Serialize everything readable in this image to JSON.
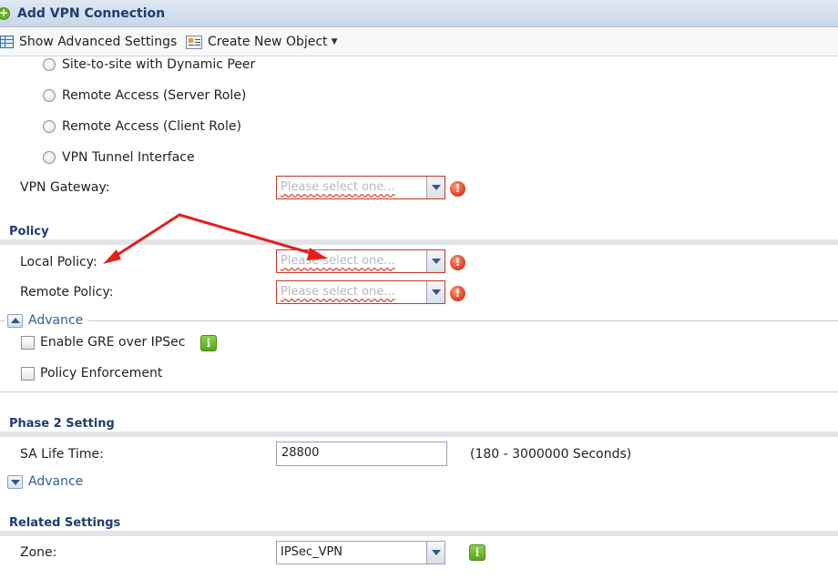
{
  "window": {
    "title": "Add VPN Connection"
  },
  "toolbar": {
    "show_advanced": "Show Advanced Settings",
    "create_object": "Create New Object"
  },
  "scenario_options": [
    "Site-to-site with Dynamic Peer",
    "Remote Access (Server Role)",
    "Remote Access (Client Role)",
    "VPN Tunnel Interface"
  ],
  "gateway": {
    "label": "VPN Gateway:",
    "placeholder": "Please select one..."
  },
  "policy": {
    "section_title": "Policy",
    "local_label": "Local Policy:",
    "local_placeholder": "Please select one...",
    "remote_label": "Remote Policy:",
    "remote_placeholder": "Please select one...",
    "advance_label": "Advance",
    "gre_label": "Enable GRE over IPSec",
    "enforcement_label": "Policy Enforcement"
  },
  "phase2": {
    "section_title": "Phase 2 Setting",
    "sa_label": "SA Life Time:",
    "sa_value": "28800",
    "sa_hint": "(180 - 3000000 Seconds)",
    "advance_label": "Advance"
  },
  "related": {
    "section_title": "Related Settings",
    "zone_label": "Zone:",
    "zone_value": "IPSec_VPN"
  },
  "icons": {
    "error": "exclamation-circle",
    "info": "info-square",
    "title": "add-circle"
  },
  "colors": {
    "section_title": "#1d3e6e",
    "error_border": "#c0392b",
    "annotation_arrow": "#e3201b",
    "info_green": "#6fb62f"
  }
}
